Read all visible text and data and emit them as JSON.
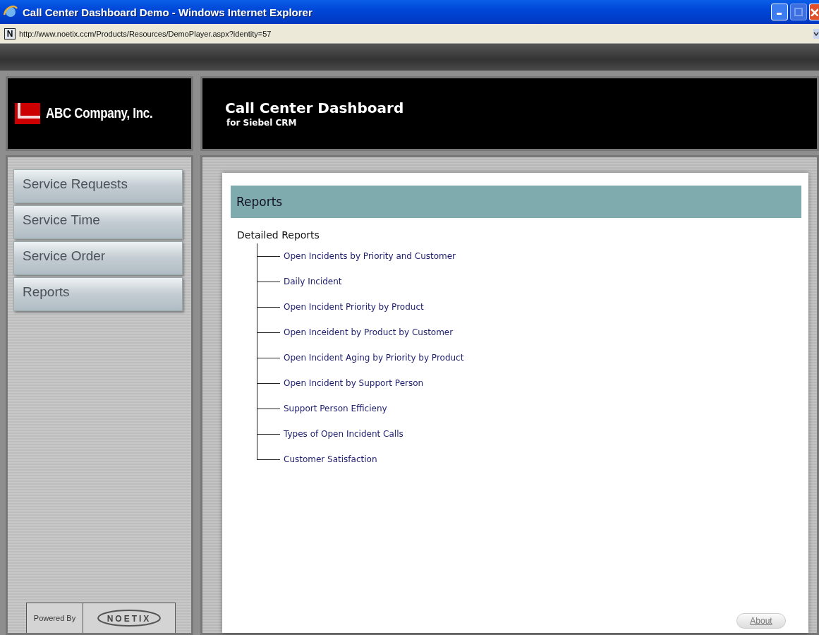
{
  "window": {
    "title": "Call Center Dashboard Demo - Windows Internet Explorer"
  },
  "address_bar": {
    "site_icon": "N",
    "url": "http://www.noetix.ccm/Products/Resources/DemoPlayer.aspx?identity=57"
  },
  "header": {
    "company": "ABC Company, Inc.",
    "title": "Call Center Dashboard",
    "subtitle": "for Siebel CRM"
  },
  "sidebar": {
    "items": [
      {
        "label": "Service Requests"
      },
      {
        "label": "Service Time"
      },
      {
        "label": "Service Order"
      },
      {
        "label": "Reports"
      }
    ],
    "powered_by": {
      "label": "Powered By",
      "logo_text": "NOETIX"
    }
  },
  "panel": {
    "title": "Reports",
    "section": "Detailed Reports",
    "reports": [
      {
        "label": "Open Incidents by Priority and Customer"
      },
      {
        "label": "Daily Incident"
      },
      {
        "label": "Open Incident Priority by Product"
      },
      {
        "label": "Open Inceident by Product by Customer"
      },
      {
        "label": "Open Incident Aging by Priority by Product"
      },
      {
        "label": "Open Incident by Support Person"
      },
      {
        "label": "Support Person Efficieny"
      },
      {
        "label": "Types of Open Incident Calls"
      },
      {
        "label": "Customer Satisfaction"
      }
    ],
    "about_button": "About"
  }
}
